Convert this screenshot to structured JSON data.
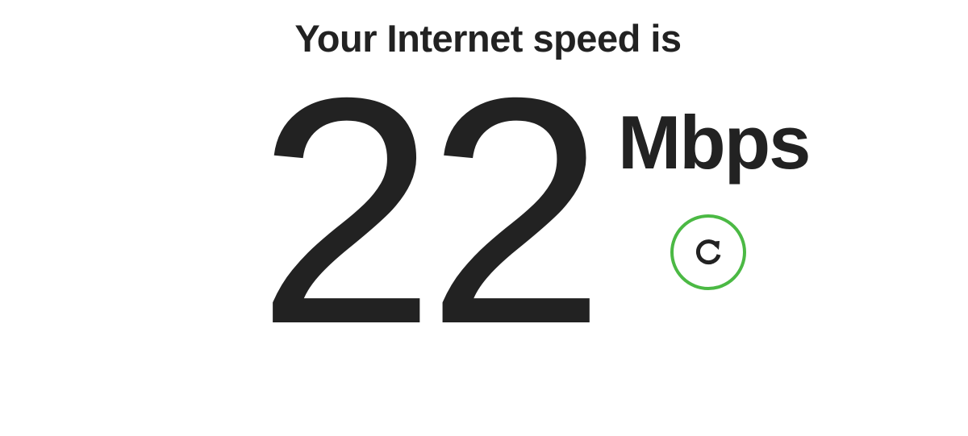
{
  "headline": "Your Internet speed is",
  "speed": {
    "value": "22",
    "units": "Mbps"
  },
  "refresh_button": {
    "icon": "refresh-icon",
    "accent_color": "#4bb944"
  },
  "colors": {
    "text": "#222222",
    "background": "#ffffff",
    "accent": "#4bb944"
  }
}
